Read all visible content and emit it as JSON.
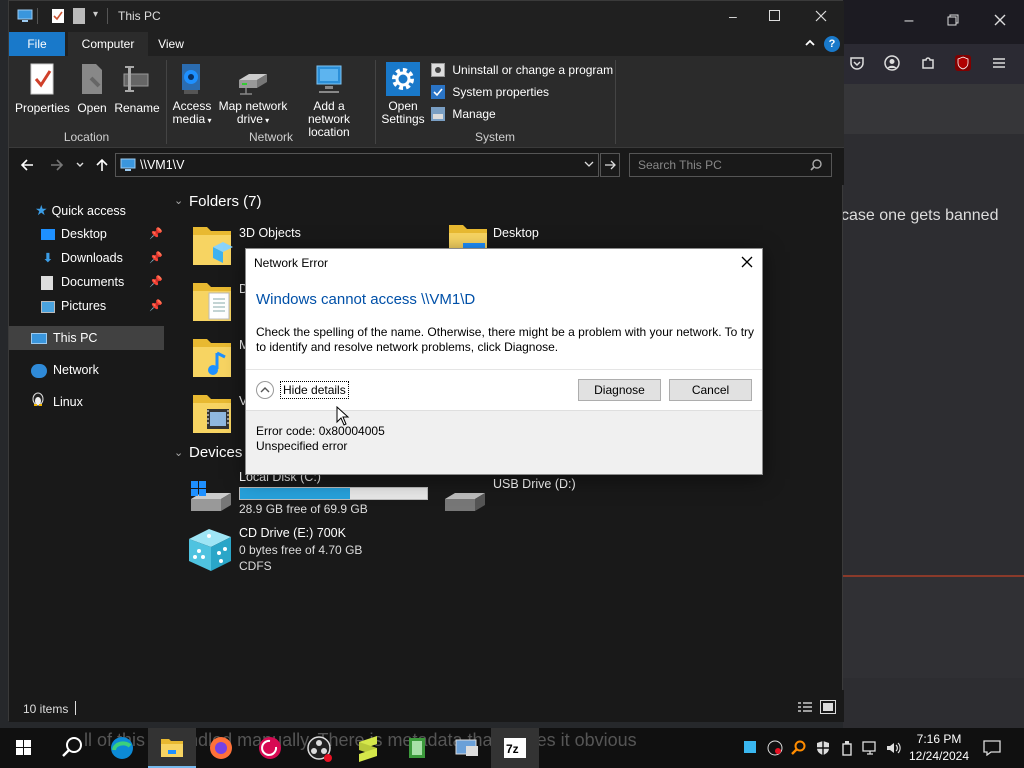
{
  "window": {
    "title": "This PC"
  },
  "ribbon": {
    "tabs": [
      "File",
      "Computer",
      "View"
    ],
    "location": {
      "label": "Location",
      "properties": "Properties",
      "open": "Open",
      "rename": "Rename"
    },
    "network": {
      "label": "Network",
      "access_media_1": "Access",
      "access_media_2": "media",
      "map_drive_1": "Map network",
      "map_drive_2": "drive",
      "add_location_1": "Add a network",
      "add_location_2": "location"
    },
    "system": {
      "label": "System",
      "open_settings_1": "Open",
      "open_settings_2": "Settings",
      "uninstall": "Uninstall or change a program",
      "system_properties": "System properties",
      "manage": "Manage"
    }
  },
  "address": {
    "path": "\\\\VM1\\V",
    "search_placeholder": "Search This PC"
  },
  "nav": {
    "quick_access": "Quick access",
    "items": [
      "Desktop",
      "Downloads",
      "Documents",
      "Pictures"
    ],
    "this_pc": "This PC",
    "network": "Network",
    "linux": "Linux"
  },
  "content": {
    "folders_heading": "Folders (7)",
    "folder_3d": "3D Objects",
    "folder_desktop": "Desktop",
    "folder_d": "D",
    "folder_m": "M",
    "folder_v": "V",
    "devices_heading": "Devices",
    "local_disk": "Local Disk (C:)",
    "local_disk_free": "28.9 GB free of 69.9 GB",
    "local_disk_used_fraction": 0.587,
    "usb": "USB Drive (D:)",
    "cd": "CD Drive (E:) 700K",
    "cd_free": "0 bytes free of 4.70 GB",
    "cd_fs": "CDFS"
  },
  "status": {
    "items": "10 items"
  },
  "dialog": {
    "title": "Network Error",
    "heading": "Windows cannot access \\\\VM1\\D",
    "message_1": "Check the spelling of the name. Otherwise, there might be a problem with your network. To try",
    "message_2": "to identify and resolve network problems, click Diagnose.",
    "hide_details": "Hide details",
    "diagnose": "Diagnose",
    "cancel": "Cancel",
    "error_code": "Error code: 0x80004005",
    "error_desc": "Unspecified error"
  },
  "browser": {
    "snippet": "case one gets banned"
  },
  "taskbar": {
    "time": "7:16 PM",
    "date": "12/24/2024",
    "caption": "ll of this is handled manually. There is metadata that makes it obvious"
  },
  "colors": {
    "accent": "#0078d7",
    "link_blue": "#0050a8",
    "disk_bar": "#26a0da"
  }
}
